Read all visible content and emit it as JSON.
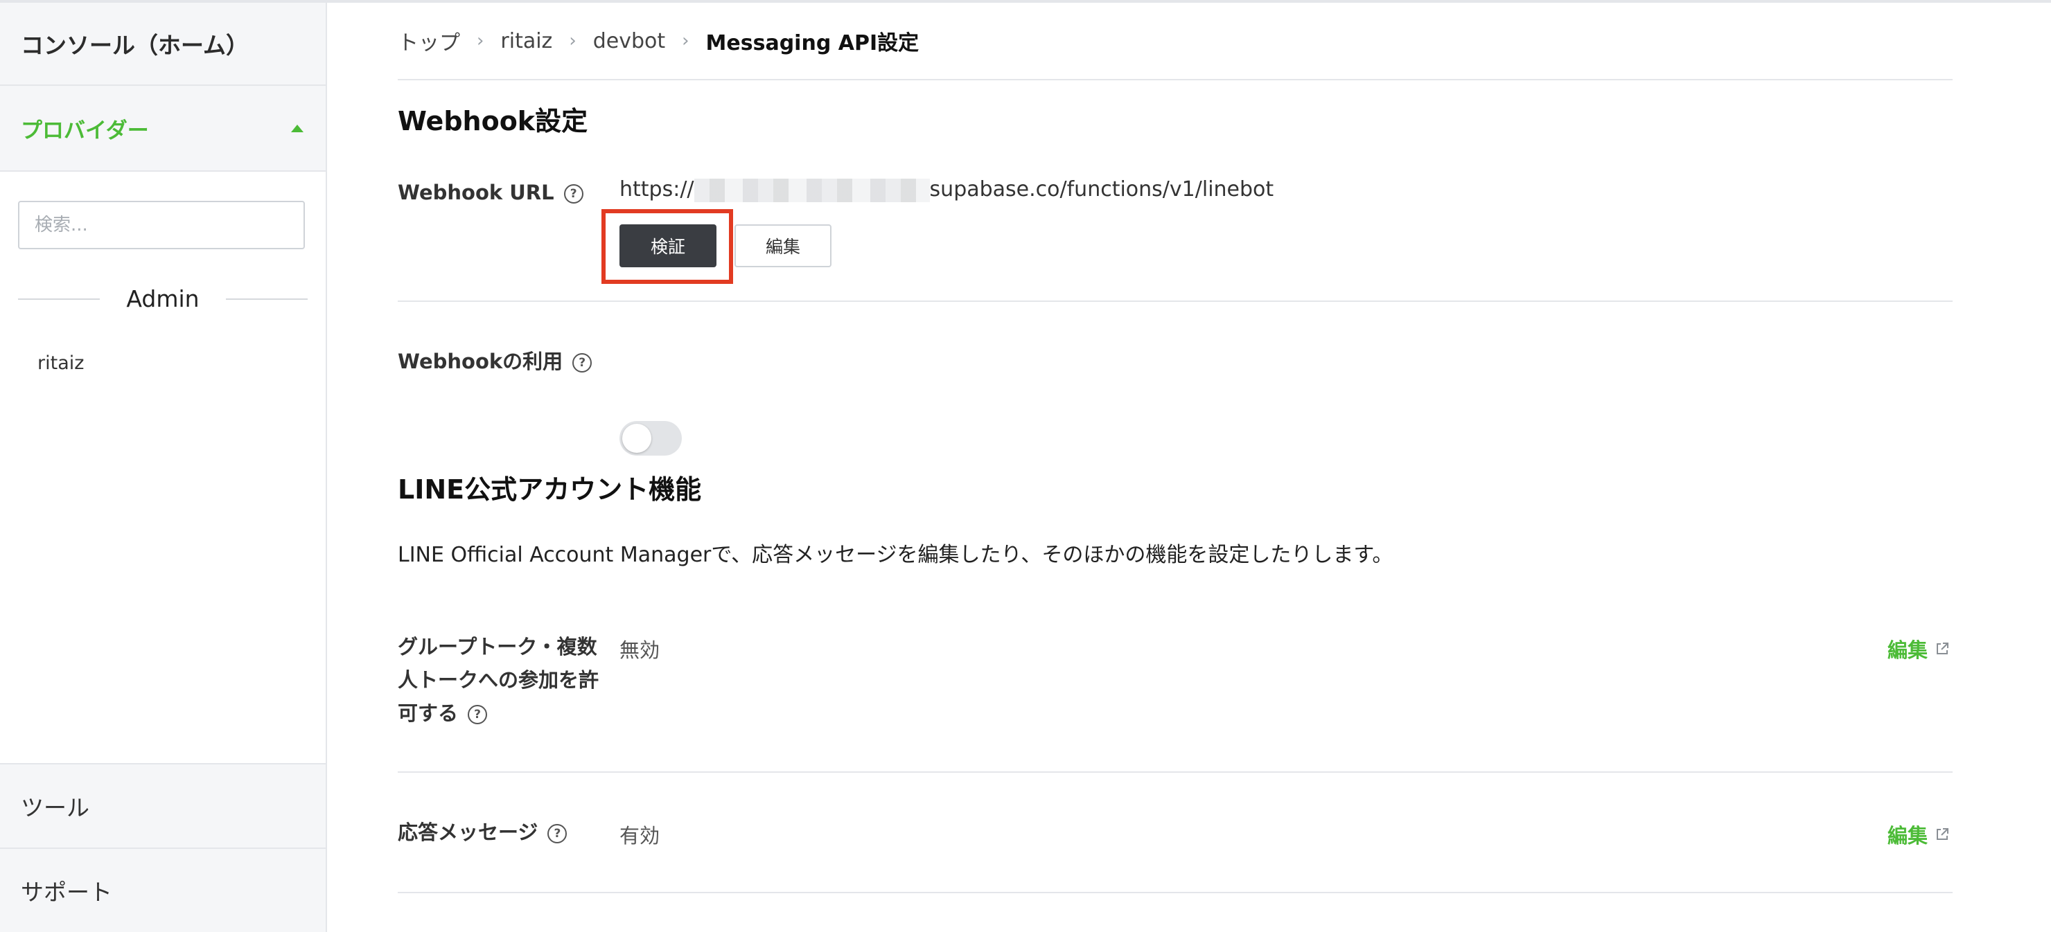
{
  "sidebar": {
    "home_label": "コンソール（ホーム）",
    "provider_label": "プロバイダー",
    "search_placeholder": "検索...",
    "group_label": "Admin",
    "items": [
      {
        "label": "ritaiz"
      }
    ],
    "tools_label": "ツール",
    "support_label": "サポート"
  },
  "breadcrumb": {
    "items": [
      "トップ",
      "ritaiz",
      "devbot"
    ],
    "current": "Messaging API設定"
  },
  "webhook_section": {
    "title": "Webhook設定",
    "url_label": "Webhook URL",
    "url_prefix": "https://",
    "url_suffix": "supabase.co/functions/v1/linebot",
    "verify_button": "検証",
    "edit_button": "編集",
    "use_label": "Webhookの利用",
    "use_enabled": false
  },
  "oa_section": {
    "title": "LINE公式アカウント機能",
    "description": "LINE Official Account Managerで、応答メッセージを編集したり、そのほかの機能を設定したりします。",
    "rows": [
      {
        "label": "グループトーク・複数人トークへの参加を許可する",
        "value": "無効",
        "edit": "編集"
      },
      {
        "label": "応答メッセージ",
        "value": "有効",
        "edit": "編集"
      }
    ]
  },
  "colors": {
    "accent_green": "#4cbb37",
    "highlight_red": "#e23b22",
    "dark_button": "#3a3d42"
  }
}
